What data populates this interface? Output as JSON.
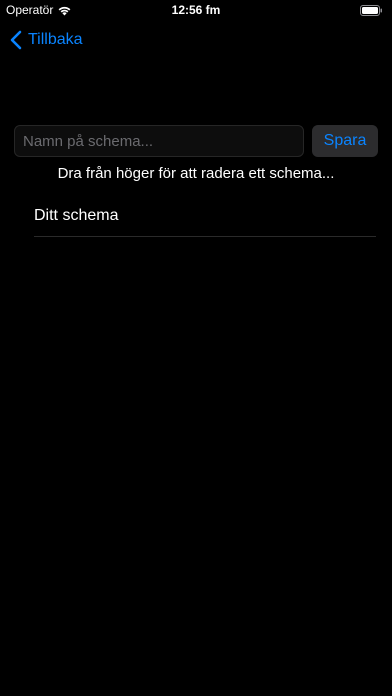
{
  "status_bar": {
    "carrier": "Operatör",
    "time": "12:56 fm",
    "icons": [
      "wifi-icon",
      "battery-icon"
    ]
  },
  "nav": {
    "back_label": "Tillbaka",
    "back_icon": "chevron-left-icon"
  },
  "form": {
    "name_placeholder": "Namn på schema...",
    "name_value": "",
    "save_label": "Spara"
  },
  "hint": "Dra från höger för att radera ett schema...",
  "schedules": [
    {
      "name": "Ditt schema"
    }
  ],
  "colors": {
    "background": "#000000",
    "accent": "#0a84ff",
    "text": "#ffffff",
    "placeholder": "#6b6b6f",
    "button_bg": "#2c2c2e",
    "separator": "#2a2a2a"
  }
}
